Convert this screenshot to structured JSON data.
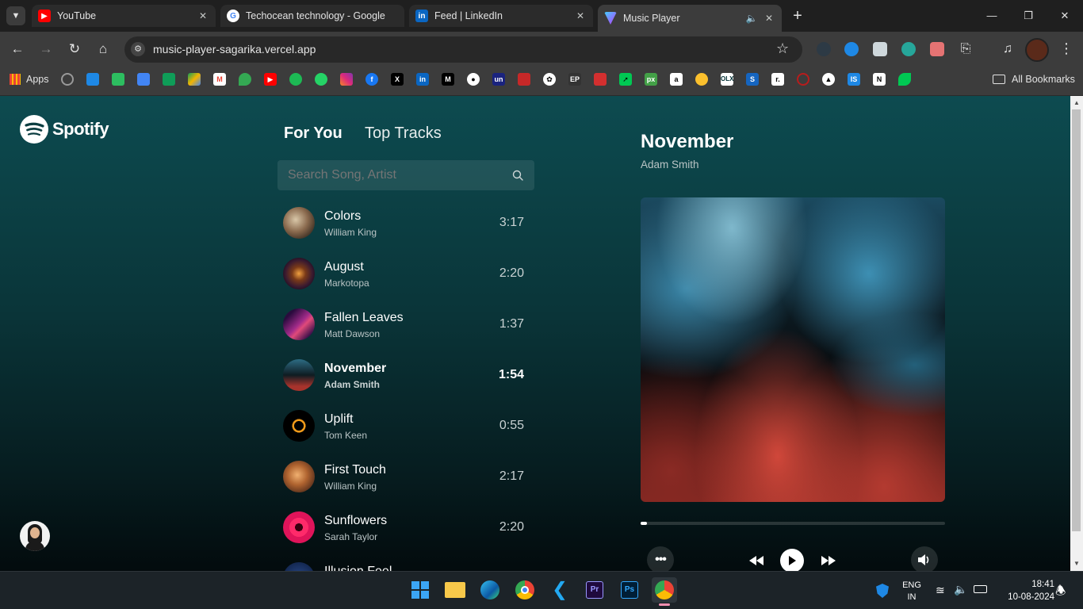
{
  "browser": {
    "tabs": [
      {
        "title": "YouTube",
        "icon": "youtube-icon"
      },
      {
        "title": "Techocean technology - Google",
        "icon": "google-icon"
      },
      {
        "title": "Feed | LinkedIn",
        "icon": "linkedin-icon"
      },
      {
        "title": "Music Player",
        "icon": "vite-icon",
        "active": true
      }
    ],
    "url": "music-player-sagarika.vercel.app",
    "bookmarks": {
      "apps_label": "Apps",
      "all_bookmarks_label": "All Bookmarks"
    }
  },
  "app": {
    "logo_text": "Spotify",
    "nav": {
      "for_you": "For You",
      "top_tracks": "Top Tracks"
    },
    "search": {
      "placeholder": "Search Song, Artist"
    },
    "tracks": [
      {
        "name": "Colors",
        "artist": "William King",
        "duration": "3:17"
      },
      {
        "name": "August",
        "artist": "Markotopa",
        "duration": "2:20"
      },
      {
        "name": "Fallen Leaves",
        "artist": "Matt Dawson",
        "duration": "1:37"
      },
      {
        "name": "November",
        "artist": "Adam Smith",
        "duration": "1:54"
      },
      {
        "name": "Uplift",
        "artist": "Tom Keen",
        "duration": "0:55"
      },
      {
        "name": "First Touch",
        "artist": "William King",
        "duration": "2:17"
      },
      {
        "name": "Sunflowers",
        "artist": "Sarah Taylor",
        "duration": "2:20"
      },
      {
        "name": "Illusion Feel",
        "artist": "",
        "duration": ""
      }
    ],
    "now_playing": {
      "title": "November",
      "artist": "Adam Smith",
      "progress": 0.02
    }
  },
  "taskbar": {
    "lang_line1": "ENG",
    "lang_line2": "IN",
    "time": "18:41",
    "date": "10-08-2024"
  },
  "colors": {
    "bg_top": "#0d4b50",
    "bg_bottom": "#030b0d",
    "accent": "#ffffff"
  }
}
